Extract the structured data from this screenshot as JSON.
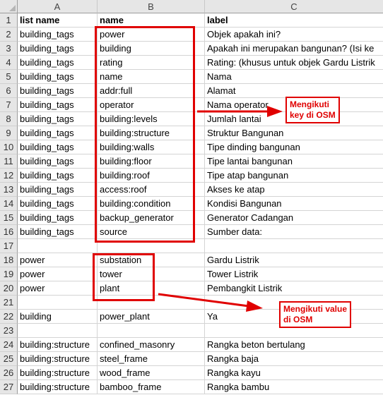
{
  "columns": [
    "A",
    "B",
    "C"
  ],
  "rows": [
    {
      "num": "1",
      "a": "list name",
      "b": "name",
      "c": "label"
    },
    {
      "num": "2",
      "a": "building_tags",
      "b": "power",
      "c": "Objek apakah ini?"
    },
    {
      "num": "3",
      "a": "building_tags",
      "b": "building",
      "c": "Apakah ini merupakan bangunan? (Isi ke"
    },
    {
      "num": "4",
      "a": "building_tags",
      "b": "rating",
      "c": "Rating: (khusus untuk objek Gardu Listrik"
    },
    {
      "num": "5",
      "a": "building_tags",
      "b": "name",
      "c": "Nama"
    },
    {
      "num": "6",
      "a": "building_tags",
      "b": "addr:full",
      "c": "Alamat"
    },
    {
      "num": "7",
      "a": "building_tags",
      "b": "operator",
      "c": "Nama operator"
    },
    {
      "num": "8",
      "a": "building_tags",
      "b": "building:levels",
      "c": "Jumlah lantai"
    },
    {
      "num": "9",
      "a": "building_tags",
      "b": "building:structure",
      "c": "Struktur Bangunan"
    },
    {
      "num": "10",
      "a": "building_tags",
      "b": "building:walls",
      "c": "Tipe dinding bangunan"
    },
    {
      "num": "11",
      "a": "building_tags",
      "b": "building:floor",
      "c": "Tipe lantai bangunan"
    },
    {
      "num": "12",
      "a": "building_tags",
      "b": "building:roof",
      "c": "Tipe atap bangunan"
    },
    {
      "num": "13",
      "a": "building_tags",
      "b": "access:roof",
      "c": "Akses ke atap"
    },
    {
      "num": "14",
      "a": "building_tags",
      "b": "building:condition",
      "c": "Kondisi Bangunan"
    },
    {
      "num": "15",
      "a": "building_tags",
      "b": "backup_generator",
      "c": "Generator Cadangan"
    },
    {
      "num": "16",
      "a": "building_tags",
      "b": "source",
      "c": "Sumber data:"
    },
    {
      "num": "17",
      "a": "",
      "b": "",
      "c": ""
    },
    {
      "num": "18",
      "a": "power",
      "b": "substation",
      "c": "Gardu Listrik"
    },
    {
      "num": "19",
      "a": "power",
      "b": "tower",
      "c": "Tower Listrik"
    },
    {
      "num": "20",
      "a": "power",
      "b": "plant",
      "c": "Pembangkit Listrik"
    },
    {
      "num": "21",
      "a": "",
      "b": "",
      "c": ""
    },
    {
      "num": "22",
      "a": "building",
      "b": "power_plant",
      "c": "Ya"
    },
    {
      "num": "23",
      "a": "",
      "b": "",
      "c": ""
    },
    {
      "num": "24",
      "a": "building:structure",
      "b": "confined_masonry",
      "c": "Rangka beton bertulang"
    },
    {
      "num": "25",
      "a": "building:structure",
      "b": "steel_frame",
      "c": "Rangka baja"
    },
    {
      "num": "26",
      "a": "building:structure",
      "b": "wood_frame",
      "c": "Rangka kayu"
    },
    {
      "num": "27",
      "a": "building:structure",
      "b": "bamboo_frame",
      "c": "Rangka bambu"
    }
  ],
  "annotations": {
    "key_callout": [
      "Mengikuti",
      "key di OSM"
    ],
    "value_callout": [
      "Mengikuti value",
      "di OSM"
    ],
    "accent_color": "#e00000"
  }
}
